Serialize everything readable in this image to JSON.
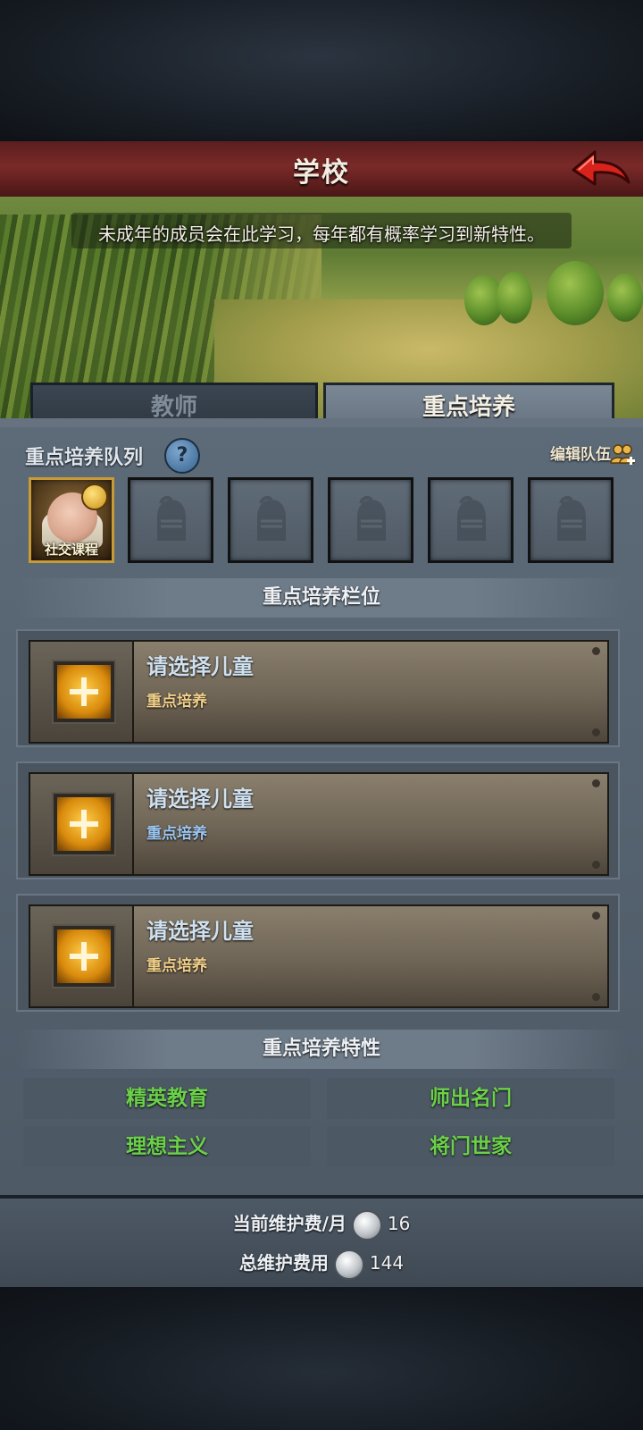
{
  "header": {
    "title": "学校"
  },
  "banner": {
    "description": "未成年的成员会在此学习，每年都有概率学习到新特性。"
  },
  "tabs": [
    {
      "label": "教师",
      "active": false
    },
    {
      "label": "重点培养",
      "active": true
    }
  ],
  "queue": {
    "label": "重点培养队列",
    "edit_label": "编辑队伍",
    "slots": [
      {
        "filled": true,
        "caption": "社交课程"
      },
      {
        "filled": false
      },
      {
        "filled": false
      },
      {
        "filled": false
      },
      {
        "filled": false
      },
      {
        "filled": false
      }
    ]
  },
  "focus_slots": {
    "heading": "重点培养栏位",
    "items": [
      {
        "title": "请选择儿童",
        "subtitle": "重点培养",
        "subtitle_color": "#f1d08a"
      },
      {
        "title": "请选择儿童",
        "subtitle": "重点培养",
        "subtitle_color": "#9cc6f0"
      },
      {
        "title": "请选择儿童",
        "subtitle": "重点培养",
        "subtitle_color": "#f1d08a"
      }
    ]
  },
  "traits": {
    "heading": "重点培养特性",
    "items": [
      "精英教育",
      "师出名门",
      "理想主义",
      "将门世家"
    ],
    "color": "#6bd04a"
  },
  "footer": {
    "monthly_label": "当前维护费/月",
    "monthly_value": "16",
    "total_label": "总维护费用",
    "total_value": "144"
  },
  "icons": {
    "back": "back-arrow-icon",
    "help": "help-icon",
    "edit_team": "people-add-icon",
    "coin": "silver-coin-icon",
    "empty_slot": "knight-helmet-icon"
  }
}
